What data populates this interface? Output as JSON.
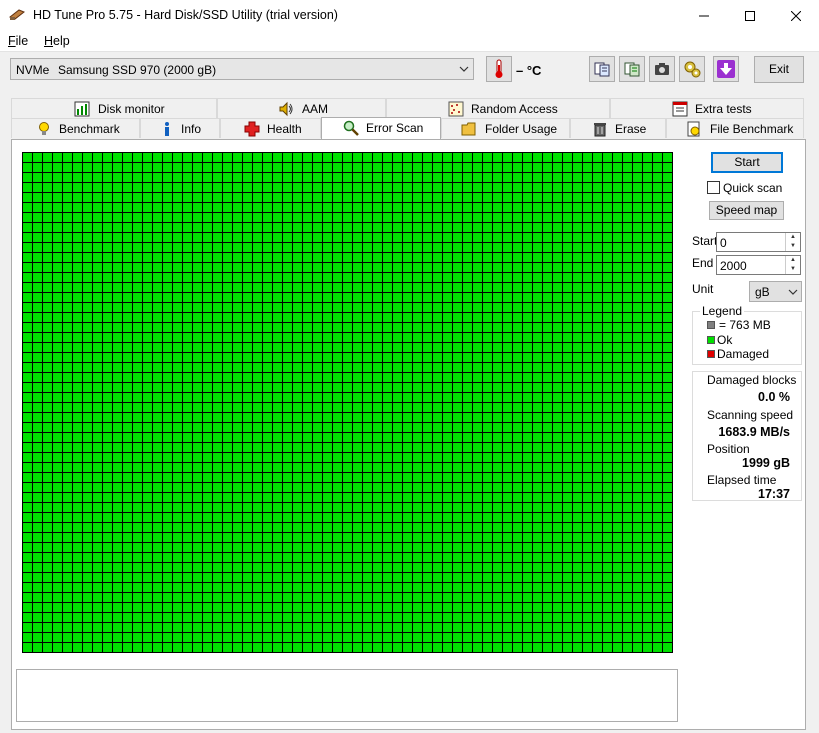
{
  "window": {
    "title": "HD Tune Pro 5.75 - Hard Disk/SSD Utility (trial version)",
    "minimize_icon": "minimize-icon",
    "maximize_icon": "maximize-icon",
    "close_icon": "close-icon"
  },
  "menu": {
    "file": "File",
    "help": "Help"
  },
  "toolbar": {
    "drive_type": "NVMe",
    "drive_name": "Samsung SSD 970 (2000 gB)",
    "temperature": "– °C",
    "exit_label": "Exit",
    "icons": [
      "thermometer-icon",
      "copy-text-icon",
      "copy-info-icon",
      "camera-icon",
      "options-icon",
      "save-icon"
    ]
  },
  "tabs": {
    "row1": [
      {
        "label": "Disk monitor",
        "icon": "disk-monitor-icon"
      },
      {
        "label": "AAM",
        "icon": "speaker-icon"
      },
      {
        "label": "Random Access",
        "icon": "random-access-icon"
      },
      {
        "label": "Extra tests",
        "icon": "extra-tests-icon"
      }
    ],
    "row2": [
      {
        "label": "Benchmark",
        "icon": "benchmark-icon"
      },
      {
        "label": "Info",
        "icon": "info-icon"
      },
      {
        "label": "Health",
        "icon": "health-cross-icon"
      },
      {
        "label": "Error Scan",
        "icon": "magnifier-icon",
        "active": true
      },
      {
        "label": "Folder Usage",
        "icon": "folder-icon"
      },
      {
        "label": "Erase",
        "icon": "trash-icon"
      },
      {
        "label": "File Benchmark",
        "icon": "file-benchmark-icon"
      }
    ]
  },
  "scan": {
    "start_label": "Start",
    "quick_scan_label": "Quick scan",
    "quick_scan_checked": false,
    "speed_map_label": "Speed map",
    "start_field_label": "Start",
    "start_value": "0",
    "end_field_label": "End",
    "end_value": "2000",
    "unit_label": "Unit",
    "unit_value": "gB",
    "block_grid_status": "all-ok"
  },
  "legend": {
    "title": "Legend",
    "items": [
      {
        "label": "= 763 MB",
        "color": "#808080"
      },
      {
        "label": "Ok",
        "color": "#00e000"
      },
      {
        "label": "Damaged",
        "color": "#e00000"
      }
    ]
  },
  "stats": {
    "damaged_blocks_label": "Damaged blocks",
    "damaged_blocks_value": "0.0  %",
    "scanning_speed_label": "Scanning speed",
    "scanning_speed_value": "1683.9 MB/s",
    "position_label": "Position",
    "position_value": "1999 gB",
    "elapsed_label": "Elapsed time",
    "elapsed_value": "17:37"
  }
}
